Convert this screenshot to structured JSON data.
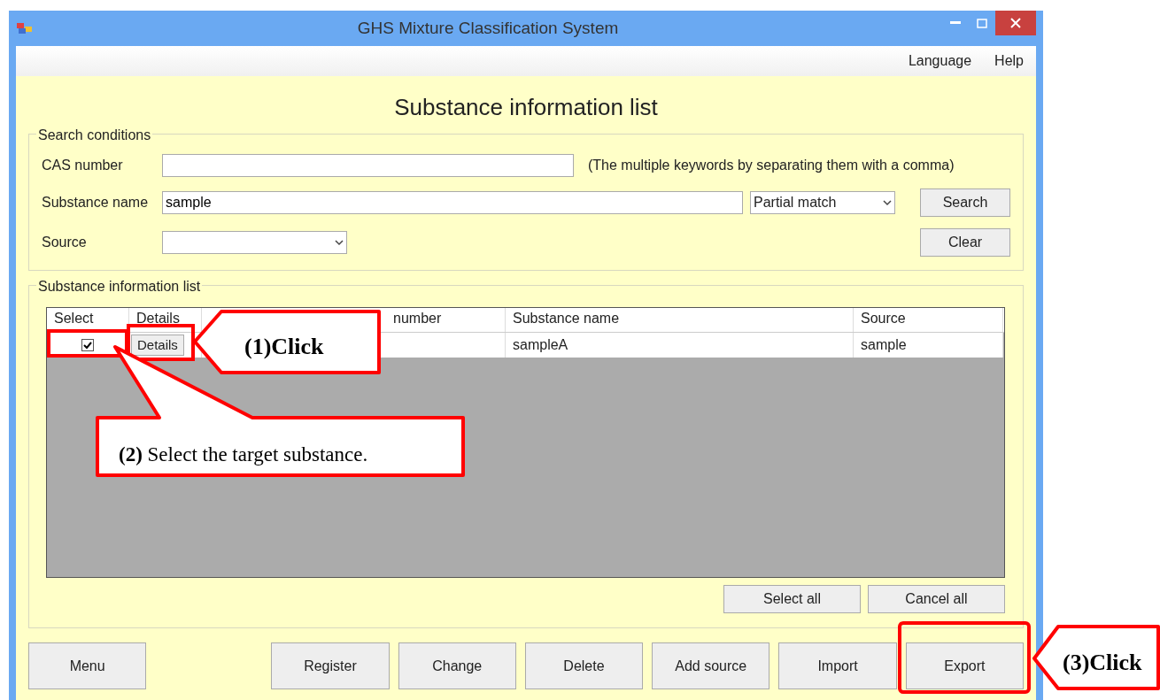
{
  "window": {
    "title": "GHS Mixture Classification System"
  },
  "menu": [
    "Language",
    "Help"
  ],
  "heading": "Substance information list",
  "search": {
    "legend": "Search conditions",
    "cas_label": "CAS number",
    "cas_note": "(The multiple keywords by separating them with a comma)",
    "name_label": "Substance name",
    "name_value": "sample",
    "match": "Partial match",
    "source_label": "Source",
    "buttons": [
      "Search",
      "Clear"
    ]
  },
  "list": {
    "legend": "Substance information list",
    "columns": [
      "Select",
      "Details",
      "number",
      "Substance name",
      "Source"
    ],
    "rows": [
      {
        "checked": true,
        "details": "Details",
        "substance_name": "sampleA",
        "source": "sample"
      }
    ],
    "buttons": [
      "Select all",
      "Cancel all"
    ]
  },
  "buttons": [
    "Menu",
    "Register",
    "Change",
    "Delete",
    "Add source",
    "Import",
    "Export"
  ],
  "annotations": [
    {
      "text": "(1)Click"
    },
    {
      "text": "**(2)** Select the target substance."
    },
    {
      "text": "(3)Click"
    }
  ]
}
